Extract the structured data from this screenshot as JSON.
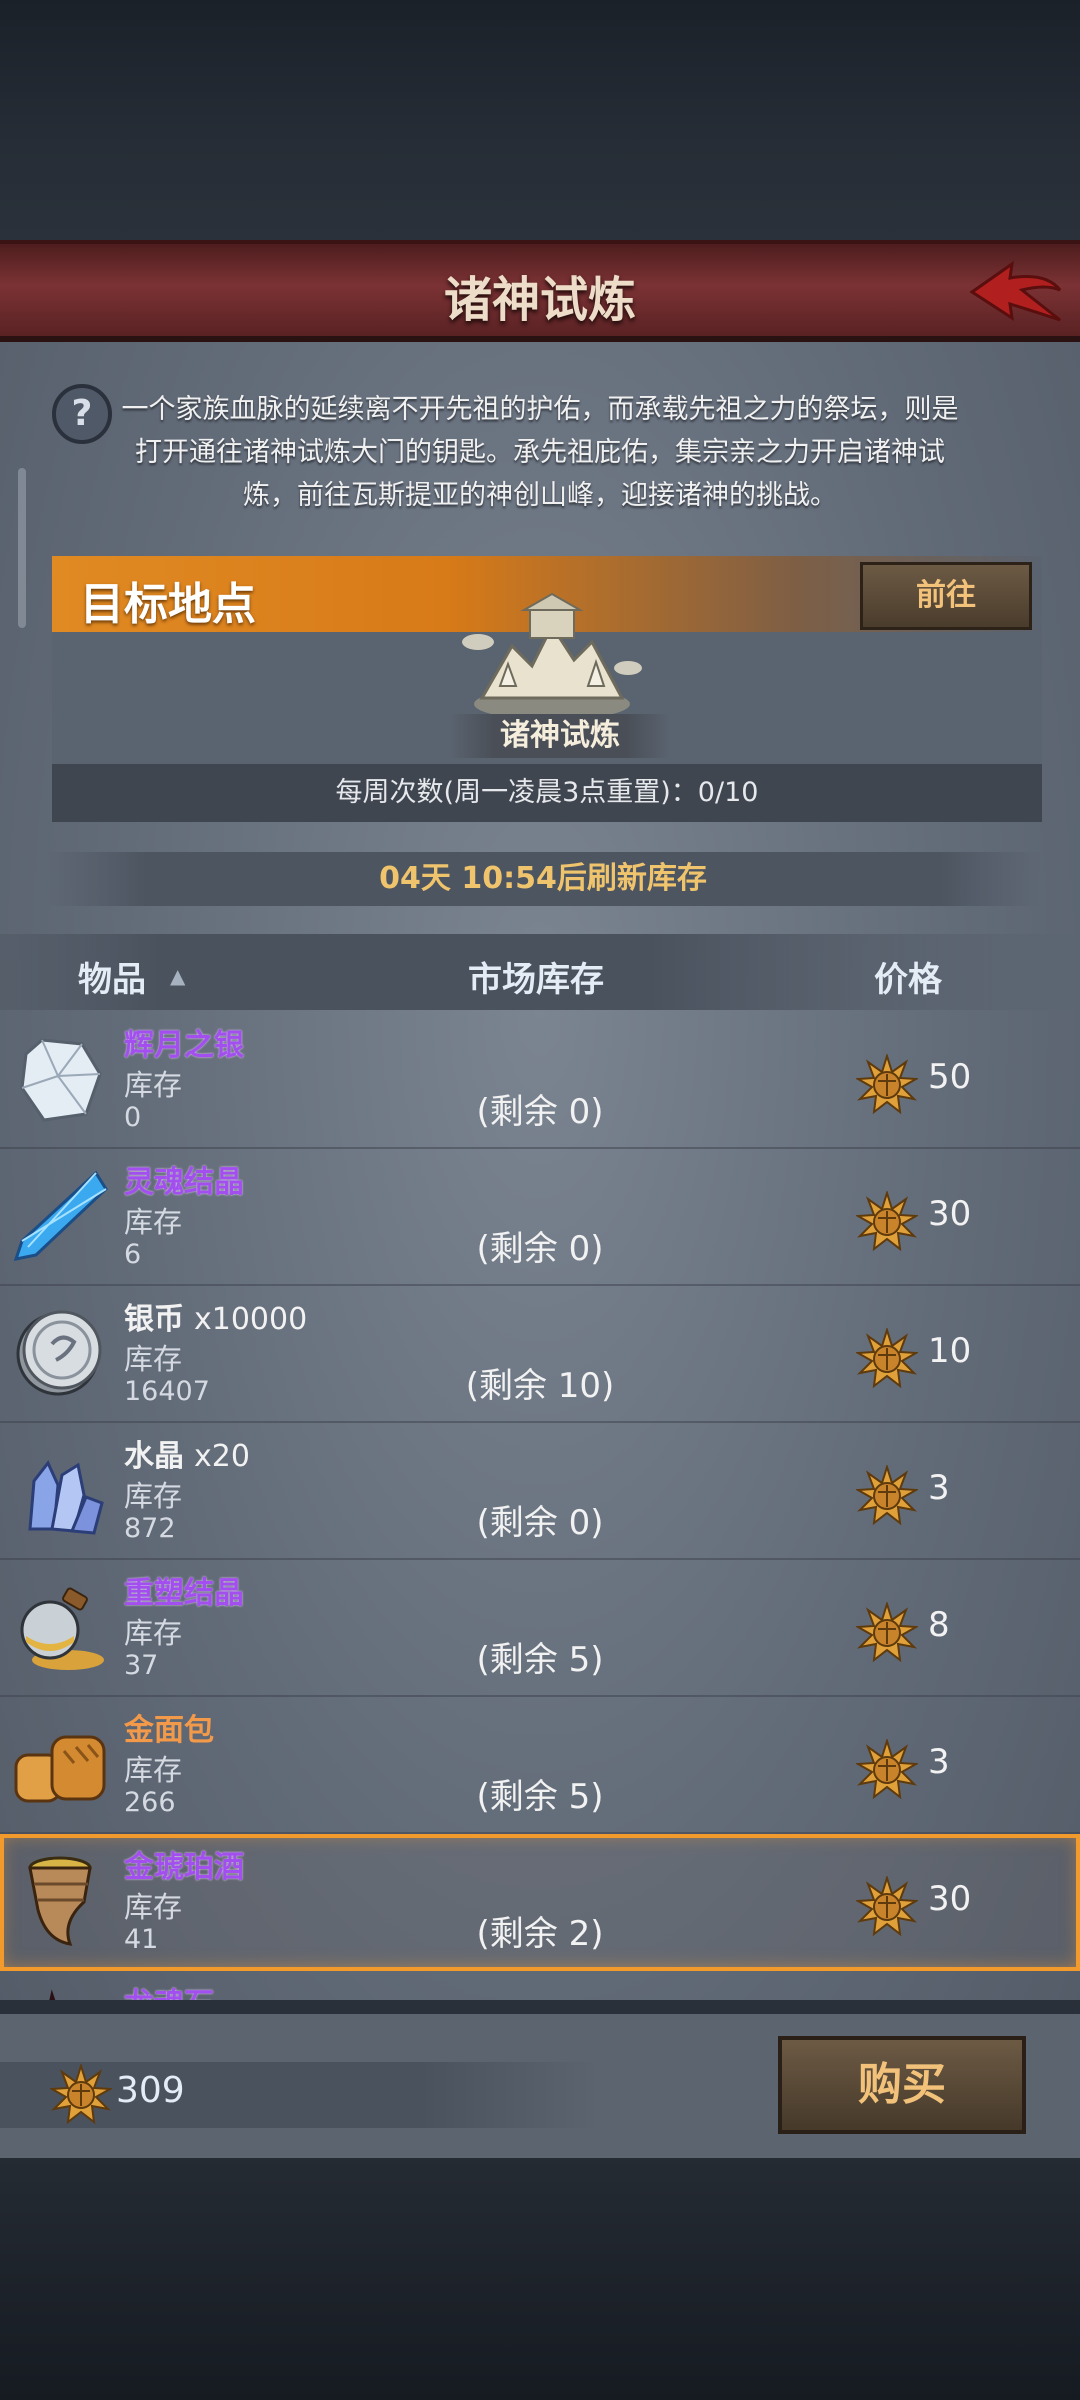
{
  "header": {
    "title": "诸神试炼"
  },
  "intro": {
    "text": "一个家族血脉的延续离不开先祖的护佑，而承载先祖之力的祭坛，则是打开通往诸神试炼大门的钥匙。承先祖庇佑，集宗亲之力开启诸神试炼，前往瓦斯提亚的神创山峰，迎接诸神的挑战。"
  },
  "target": {
    "label": "目标地点",
    "go_label": "前往",
    "place_name": "诸神试炼",
    "weekly_text": "每周次数(周一凌晨3点重置)：0/10"
  },
  "refresh_text": "04天 10:54后刷新库存",
  "columns": {
    "item": "物品",
    "stock": "市场库存",
    "price": "价格"
  },
  "items": [
    {
      "name": "辉月之银",
      "qty": "",
      "stock_label": "库存",
      "stock": "0",
      "remain": "(剩余 0)",
      "price": "50",
      "icon": "silver-ore-icon"
    },
    {
      "name": "灵魂结晶",
      "qty": "",
      "stock_label": "库存",
      "stock": "6",
      "remain": "(剩余 0)",
      "price": "30",
      "icon": "blue-crystal-icon"
    },
    {
      "name": "银币",
      "qty": "x10000",
      "stock_label": "库存",
      "stock": "16407",
      "remain": "(剩余 10)",
      "price": "10",
      "icon": "silver-coin-icon"
    },
    {
      "name": "水晶",
      "qty": "x20",
      "stock_label": "库存",
      "stock": "872",
      "remain": "(剩余 0)",
      "price": "3",
      "icon": "crystal-cluster-icon"
    },
    {
      "name": "重塑结晶",
      "qty": "",
      "stock_label": "库存",
      "stock": "37",
      "remain": "(剩余 5)",
      "price": "8",
      "icon": "potion-flask-icon"
    },
    {
      "name": "金面包",
      "qty": "",
      "stock_label": "库存",
      "stock": "266",
      "remain": "(剩余 5)",
      "price": "3",
      "icon": "bread-icon"
    },
    {
      "name": "金琥珀酒",
      "qty": "",
      "stock_label": "库存",
      "stock": "41",
      "remain": "(剩余 2)",
      "price": "30",
      "icon": "horn-cup-icon"
    },
    {
      "name": "龙魂石",
      "qty": "",
      "stock_label": "",
      "stock": "",
      "remain": "",
      "price": "",
      "icon": "dragon-stone-icon"
    }
  ],
  "footer": {
    "balance": "309",
    "buy_label": "购买"
  },
  "colors": {
    "accent_orange": "#f39a2c",
    "purple_name": "#a34ff0",
    "gold_text": "#f0c46c"
  }
}
